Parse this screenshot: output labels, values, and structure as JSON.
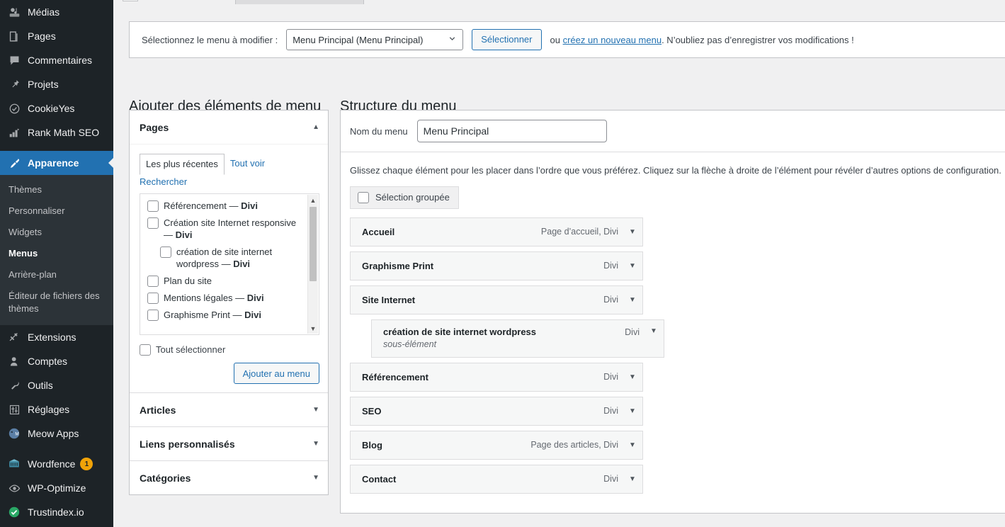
{
  "sidebar": {
    "items": [
      {
        "label": "Médias",
        "icon": "media-icon",
        "current": false
      },
      {
        "label": "Pages",
        "icon": "pages-icon",
        "current": false
      },
      {
        "label": "Commentaires",
        "icon": "comments-icon",
        "current": false
      },
      {
        "label": "Projets",
        "icon": "pin-icon",
        "current": false
      },
      {
        "label": "CookieYes",
        "icon": "cookie-icon",
        "current": false
      },
      {
        "label": "Rank Math SEO",
        "icon": "rankmath-icon",
        "current": false
      },
      {
        "label": "Apparence",
        "icon": "appearance-brush-icon",
        "current": true
      }
    ],
    "submenu": [
      {
        "label": "Thèmes",
        "current": false
      },
      {
        "label": "Personnaliser",
        "current": false
      },
      {
        "label": "Widgets",
        "current": false
      },
      {
        "label": "Menus",
        "current": true
      },
      {
        "label": "Arrière-plan",
        "current": false
      },
      {
        "label": "Éditeur de fichiers des thèmes",
        "current": false
      }
    ],
    "items_bottom": [
      {
        "label": "Extensions",
        "icon": "plugin-icon",
        "badge": null
      },
      {
        "label": "Comptes",
        "icon": "users-icon",
        "badge": null
      },
      {
        "label": "Outils",
        "icon": "tools-wrench-icon",
        "badge": null
      },
      {
        "label": "Réglages",
        "icon": "settings-sliders-icon",
        "badge": null
      },
      {
        "label": "Meow Apps",
        "icon": "meow-apps-icon",
        "badge": null
      },
      {
        "label": "Wordfence",
        "icon": "wordfence-icon",
        "badge": "1"
      },
      {
        "label": "WP-Optimize",
        "icon": "wp-optimize-eye-icon",
        "badge": null
      },
      {
        "label": "Trustindex.io",
        "icon": "trustindex-check-icon",
        "badge": null
      }
    ],
    "colors": {
      "background": "#1d2327",
      "submenu_background": "#2c3338",
      "current_highlight": "#2271b1",
      "badge": "#f0a308"
    }
  },
  "menu_select_bar": {
    "label": "Sélectionnez le menu à modifier :",
    "selected_menu": "Menu Principal (Menu Principal)",
    "options": [
      "Menu Principal (Menu Principal)"
    ],
    "select_button": "Sélectionner",
    "tail_before": "ou",
    "tail_link": "créez un nouveau menu",
    "tail_after": ". N’oubliez pas d’enregistrer vos modifications !"
  },
  "left_column": {
    "title": "Ajouter des éléments de menu",
    "accordions": [
      {
        "label": "Pages",
        "open": true,
        "caret": "▲"
      },
      {
        "label": "Articles",
        "open": false,
        "caret": "▼"
      },
      {
        "label": "Liens personnalisés",
        "open": false,
        "caret": "▼"
      },
      {
        "label": "Catégories",
        "open": false,
        "caret": "▼"
      }
    ],
    "pages_panel": {
      "tabs": [
        {
          "label": "Les plus récentes",
          "active": true
        },
        {
          "label": "Tout voir",
          "active": false
        },
        {
          "label": "Rechercher",
          "active": false
        }
      ],
      "page_items": [
        {
          "text": "Référencement — Divi",
          "bold_suffix": "Divi",
          "prefix": "Référencement — ",
          "indent": false,
          "checkbox": true
        },
        {
          "text": "Création site Internet responsive — Divi",
          "prefix": "Création site Internet responsive — ",
          "bold_suffix": "Divi",
          "indent": false,
          "checkbox": true
        },
        {
          "text": "création de site internet wordpress — Divi",
          "prefix": "création de site internet wordpress — ",
          "bold_suffix": "Divi",
          "indent": true,
          "checkbox": true
        },
        {
          "text": "Plan du site",
          "prefix": "Plan du site",
          "bold_suffix": "",
          "indent": false,
          "checkbox": true
        },
        {
          "text": "Mentions légales — Divi",
          "prefix": "Mentions légales — ",
          "bold_suffix": "Divi",
          "indent": false,
          "checkbox": true
        },
        {
          "text": "Graphisme Print — Divi",
          "prefix": "Graphisme Print — ",
          "bold_suffix": "Divi",
          "indent": false,
          "checkbox": true
        }
      ],
      "select_all_label": "Tout sélectionner",
      "add_button": "Ajouter au menu"
    }
  },
  "right_column": {
    "title": "Structure du menu",
    "menu_name_label": "Nom du menu",
    "menu_name_value": "Menu Principal",
    "hint": "Glissez chaque élément pour les placer dans l’ordre que vous préférez. Cliquez sur la flèche à droite de l’élément pour révéler d’autres options de configuration.",
    "bulk_select_label": "Sélection groupée",
    "menu_items": [
      {
        "title": "Accueil",
        "meta": "Page d’accueil, Divi",
        "level": 1,
        "sub_label": ""
      },
      {
        "title": "Graphisme Print",
        "meta": "Divi",
        "level": 1,
        "sub_label": ""
      },
      {
        "title": "Site Internet",
        "meta": "Divi",
        "level": 1,
        "sub_label": ""
      },
      {
        "title": "création de site internet wordpress",
        "meta": "Divi",
        "level": 2,
        "sub_label": "sous-élément"
      },
      {
        "title": "Référencement",
        "meta": "Divi",
        "level": 1,
        "sub_label": ""
      },
      {
        "title": "SEO",
        "meta": "Divi",
        "level": 1,
        "sub_label": ""
      },
      {
        "title": "Blog",
        "meta": "Page des articles, Divi",
        "level": 1,
        "sub_label": ""
      },
      {
        "title": "Contact",
        "meta": "Divi",
        "level": 1,
        "sub_label": ""
      }
    ],
    "toggle_caret": "▼"
  }
}
